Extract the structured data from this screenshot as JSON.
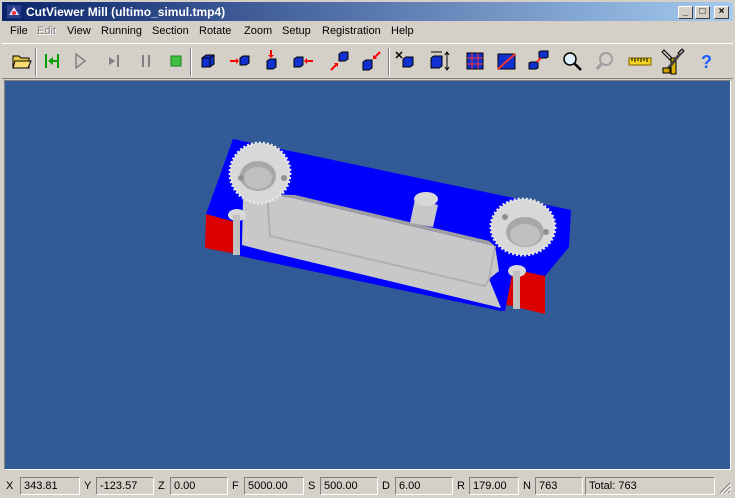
{
  "window": {
    "title": "CutViewer Mill (ultimo_simul.tmp4)"
  },
  "window_buttons": {
    "minimize": "_",
    "maximize": "□",
    "close": "×"
  },
  "menu": [
    {
      "label": "File",
      "enabled": true
    },
    {
      "label": "Edit",
      "enabled": false
    },
    {
      "label": "View",
      "enabled": true
    },
    {
      "label": "Running",
      "enabled": true
    },
    {
      "label": "Section",
      "enabled": true
    },
    {
      "label": "Rotate",
      "enabled": true
    },
    {
      "label": "Zoom",
      "enabled": true
    },
    {
      "label": "Setup",
      "enabled": true
    },
    {
      "label": "Registration",
      "enabled": true
    },
    {
      "label": "Help",
      "enabled": true
    }
  ],
  "toolbar": {
    "tools": [
      "open-folder-icon",
      "rewind-icon",
      "play-icon",
      "step-icon",
      "pause-icon",
      "stop-icon",
      "cube-view-icon",
      "cube-right-icon",
      "cube-top-icon",
      "cube-left-icon",
      "cube-iso-icon",
      "cube-iso2-icon",
      "toolpath-icon",
      "dimension-icon",
      "section-box-icon",
      "section-plane-icon",
      "multi-cube-icon",
      "zoom-icon",
      "zoom-dynamic-icon",
      "ruler-icon",
      "tools-setup-icon",
      "help-icon"
    ],
    "help_glyph": "?"
  },
  "colors": {
    "viewport_bg": "#315a96",
    "part_top": "#0000ff",
    "part_side": "#dd0000",
    "cut": "#c8c8c8"
  },
  "status": {
    "x_label": "X",
    "x_value": "343.81",
    "y_label": "Y",
    "y_value": "-123.57",
    "z_label": "Z",
    "z_value": "0.00",
    "f_label": "F",
    "f_value": "5000.00",
    "s_label": "S",
    "s_value": "500.00",
    "d_label": "D",
    "d_value": "6.00",
    "r_label": "R",
    "r_value": "179.00",
    "n_label": "N",
    "n_value": "763",
    "total": "Total: 763"
  }
}
